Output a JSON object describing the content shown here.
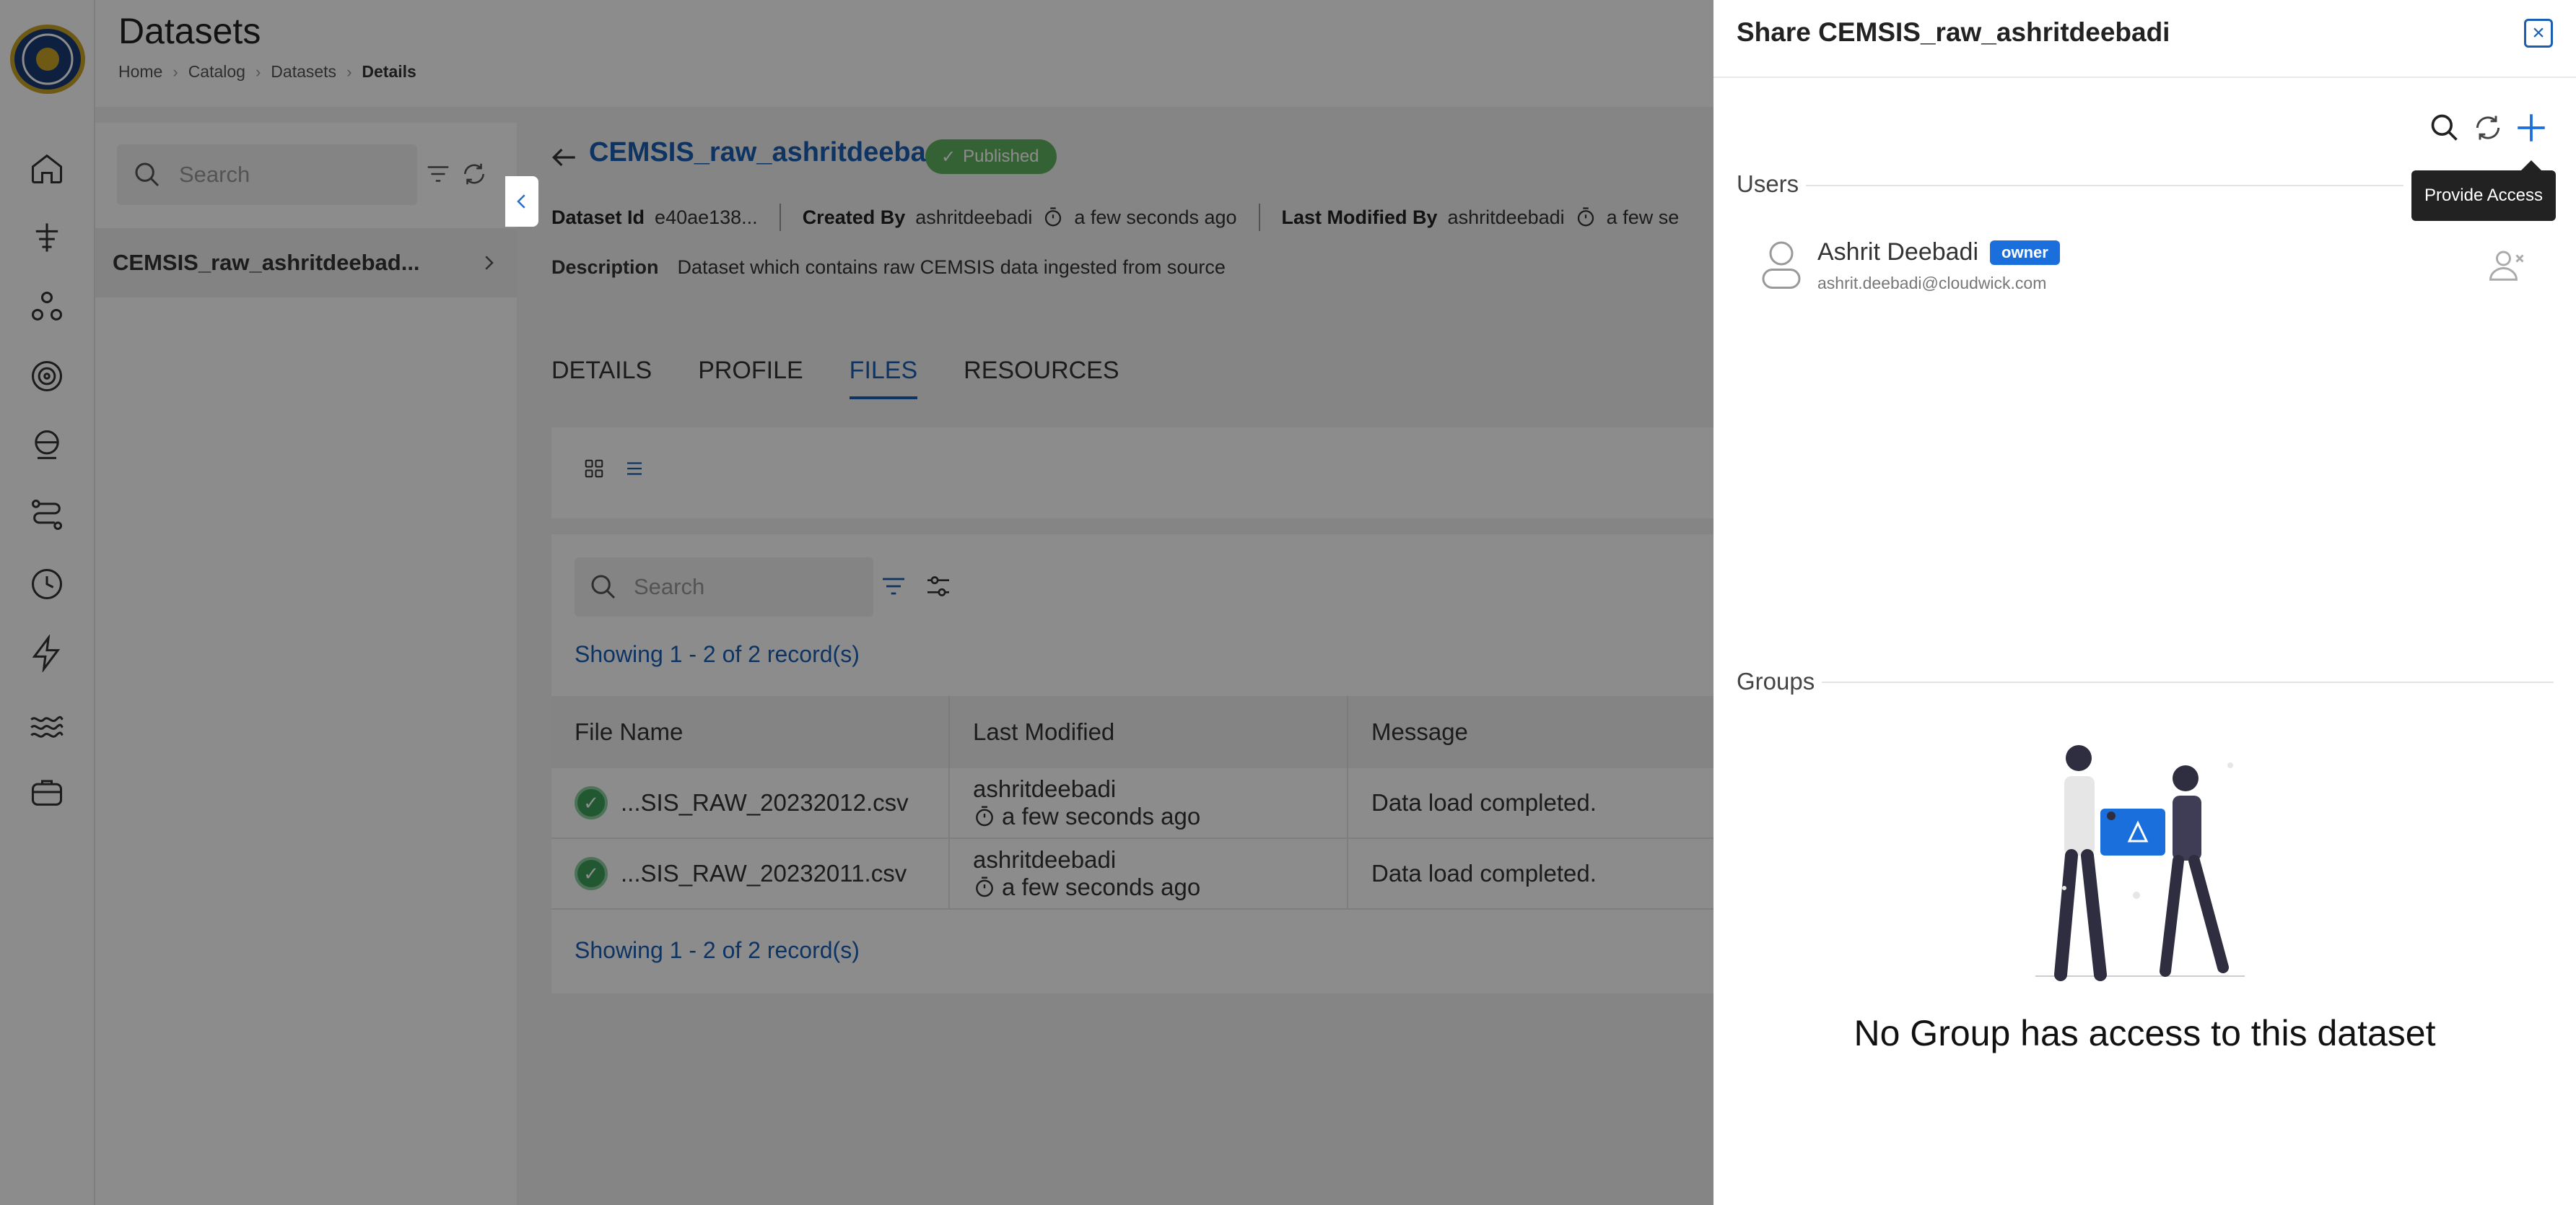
{
  "header": {
    "title": "Datasets",
    "breadcrumbs": [
      "Home",
      "Catalog",
      "Datasets",
      "Details"
    ]
  },
  "sidebar": {
    "icons": [
      "home-icon",
      "tree-icon",
      "network-icon",
      "target-icon",
      "globe-icon",
      "route-icon",
      "clock-icon",
      "bolt-icon",
      "waves-icon",
      "briefcase-icon"
    ]
  },
  "list": {
    "search_placeholder": "Search",
    "items": [
      "CEMSIS_raw_ashritdeebad..."
    ]
  },
  "dataset": {
    "name": "CEMSIS_raw_ashritdeebadi",
    "status": "Published",
    "id_label": "Dataset Id",
    "id_value": "e40ae138...",
    "created_by_label": "Created By",
    "created_by": "ashritdeebadi",
    "created_time": "a few seconds ago",
    "modified_by_label": "Last Modified By",
    "modified_by": "ashritdeebadi",
    "modified_time": "a few se",
    "description_label": "Description",
    "description": "Dataset which contains raw CEMSIS data ingested from source"
  },
  "tabs": [
    "DETAILS",
    "PROFILE",
    "FILES",
    "RESOURCES"
  ],
  "active_tab": "FILES",
  "files": {
    "search_placeholder": "Search",
    "showing_top": "Showing 1 - 2 of 2 record(s)",
    "showing_bottom": "Showing 1 - 2 of 2 record(s)",
    "columns": [
      "File Name",
      "Last Modified",
      "Message"
    ],
    "rows": [
      {
        "file": "...SIS_RAW_20232012.csv",
        "user": "ashritdeebadi",
        "time": "a few seconds ago",
        "message": "Data load completed."
      },
      {
        "file": "...SIS_RAW_20232011.csv",
        "user": "ashritdeebadi",
        "time": "a few seconds ago",
        "message": "Data load completed."
      }
    ]
  },
  "share": {
    "title": "Share CEMSIS_raw_ashritdeebadi",
    "tooltip": "Provide Access",
    "users_label": "Users",
    "user": {
      "name": "Ashrit Deebadi",
      "role": "owner",
      "email": "ashrit.deebadi@cloudwick.com"
    },
    "groups_label": "Groups",
    "empty_message": "No Group has access to this dataset"
  },
  "colors": {
    "accent": "#1a5fb4",
    "published": "#5fb35f",
    "owner_badge": "#1a6fdc"
  }
}
